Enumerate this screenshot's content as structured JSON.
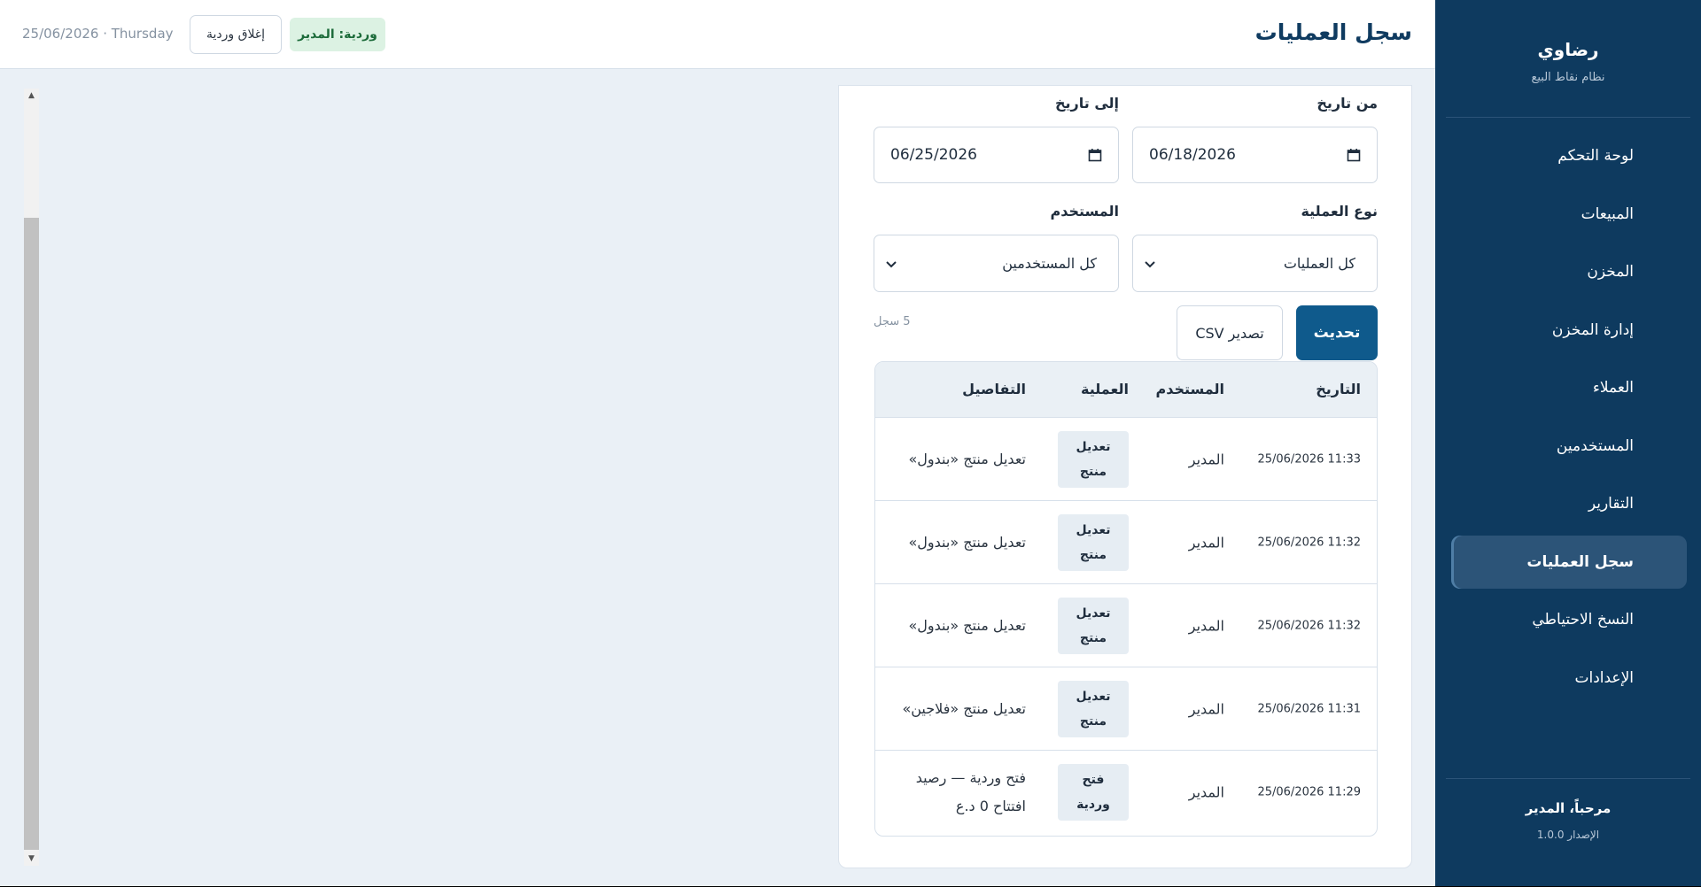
{
  "sidebar": {
    "brand_name": "رضاوي",
    "brand_subtitle": "نظام نقاط البيع",
    "items": [
      {
        "label": "لوحة التحكم",
        "active": false
      },
      {
        "label": "المبيعات",
        "active": false
      },
      {
        "label": "المخزن",
        "active": false
      },
      {
        "label": "إدارة المخزن",
        "active": false
      },
      {
        "label": "العملاء",
        "active": false
      },
      {
        "label": "المستخدمين",
        "active": false
      },
      {
        "label": "التقارير",
        "active": false
      },
      {
        "label": "سجل العمليات",
        "active": true
      },
      {
        "label": "النسخ الاحتياطي",
        "active": false
      },
      {
        "label": "الإعدادات",
        "active": false
      }
    ],
    "welcome": "مرحباً، المدير",
    "version": "الإصدار 1.0.0"
  },
  "topbar": {
    "title": "سجل العمليات",
    "shift_badge": "وردية: المدير",
    "close_shift_label": "إغلاق وردية",
    "date": "25/06/2026 · Thursday"
  },
  "filters": {
    "from_label": "من تاريخ",
    "from_value": "06/18/2026",
    "to_label": "إلى تاريخ",
    "to_value": "06/25/2026",
    "type_label": "نوع العملية",
    "type_value": "كل العمليات",
    "user_label": "المستخدم",
    "user_value": "كل المستخدمين"
  },
  "actions": {
    "refresh_label": "تحديث",
    "export_label": "تصدير CSV",
    "record_count": "5 سجل"
  },
  "table": {
    "headers": {
      "date": "التاريخ",
      "user": "المستخدم",
      "operation": "العملية",
      "details": "التفاصيل"
    },
    "rows": [
      {
        "date": "25/06/2026 11:33",
        "user": "المدير",
        "operation": "تعديل منتج",
        "details": "تعديل منتج «بندول»"
      },
      {
        "date": "25/06/2026 11:32",
        "user": "المدير",
        "operation": "تعديل منتج",
        "details": "تعديل منتج «بندول»"
      },
      {
        "date": "25/06/2026 11:32",
        "user": "المدير",
        "operation": "تعديل منتج",
        "details": "تعديل منتج «بندول»"
      },
      {
        "date": "25/06/2026 11:31",
        "user": "المدير",
        "operation": "تعديل منتج",
        "details": "تعديل منتج «فلاجين»"
      },
      {
        "date": "25/06/2026 11:29",
        "user": "المدير",
        "operation": "فتح وردية",
        "details": "فتح وردية — رصيد افتتاح 0 د.ع"
      }
    ]
  },
  "colors": {
    "sidebar_bg": "#0e3a5f",
    "primary": "#0f5a8c",
    "shift_badge_bg": "#dcf2e3",
    "shift_badge_text": "#1c6b3a"
  }
}
